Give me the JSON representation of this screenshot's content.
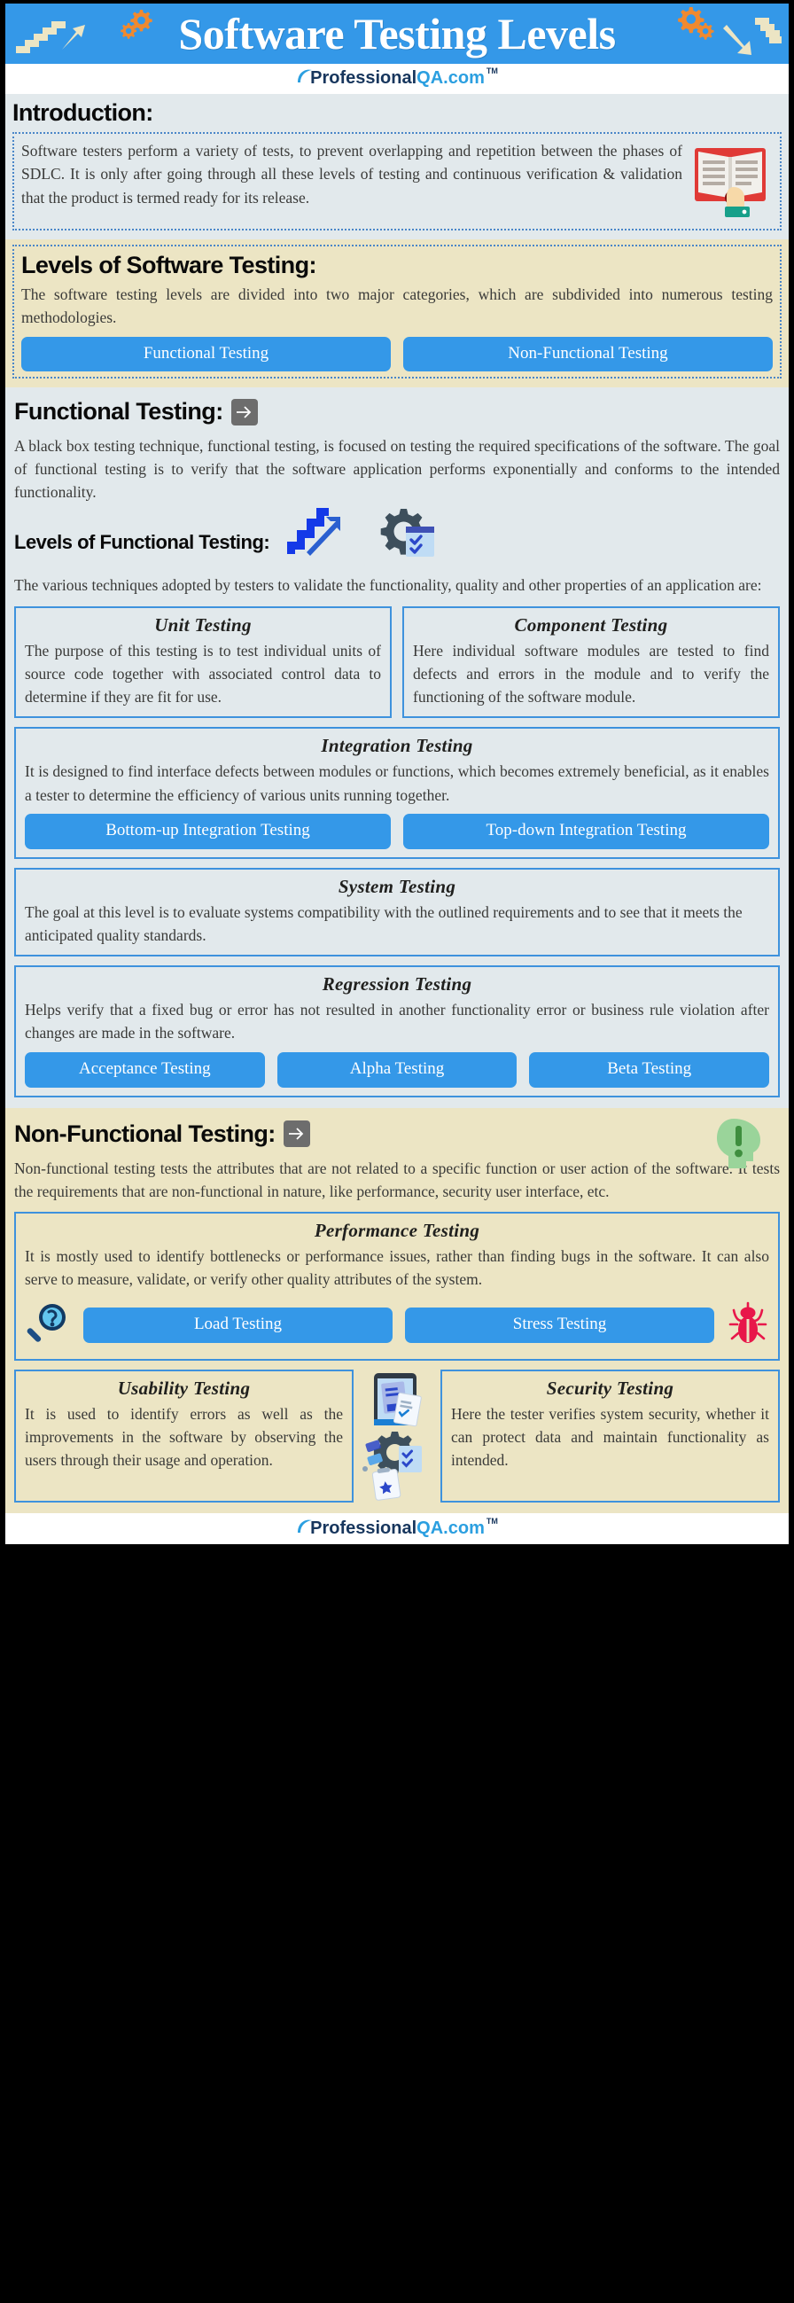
{
  "header": {
    "title": "Software Testing Levels",
    "banner_color": "#3498e8",
    "stairs_color": "#ece5c4",
    "gear_color": "#f0892f"
  },
  "logo": {
    "part1": "Professional",
    "part2": "QA",
    "part3": ".com",
    "tm": "TM",
    "color_dark": "#17365d",
    "color_blue": "#2b9fe0"
  },
  "introduction": {
    "heading": "Introduction:",
    "body": "Software testers perform a variety of tests, to prevent overlapping and repetition between the phases of SDLC. It is only after going through all these levels of testing and continuous verification & validation that the product is termed ready for its release.",
    "icon": "open-book-icon"
  },
  "levels": {
    "heading": "Levels of Software Testing:",
    "body": " The software testing levels are divided into two major categories, which are subdivided into numerous testing methodologies.",
    "buttons": [
      {
        "label": "Functional Testing"
      },
      {
        "label": "Non-Functional Testing"
      }
    ]
  },
  "functional": {
    "heading": "Functional Testing:",
    "arrow_icon": "arrow-right-icon",
    "body": "A black box testing technique, functional testing, is focused on testing the required specifications of the software. The goal of functional testing is to verify that the software application performs exponentially and conforms to the intended functionality.",
    "levels_heading": "Levels of Functional Testing:",
    "levels_body": "The various techniques adopted by testers to validate the functionality, quality and other properties of an application are:",
    "icons": [
      "stairs-up-arrow-icon",
      "gear-checklist-icon"
    ],
    "cards": [
      {
        "title": "Unit Testing",
        "body": "The purpose of this testing is to test individual units of source code together with associated control data to determine if they are fit for use."
      },
      {
        "title": "Component Testing",
        "body": "Here individual software modules are tested to find defects and errors in the module and to verify the functioning of the software module."
      }
    ],
    "integration": {
      "title": "Integration Testing",
      "body": "It is designed to find interface defects between modules or functions, which becomes extremely beneficial, as it enables a tester to determine the efficiency of various units running together.",
      "buttons": [
        {
          "label": "Bottom-up Integration Testing"
        },
        {
          "label": "Top-down Integration Testing"
        }
      ]
    },
    "system": {
      "title": "System Testing",
      "body": "The goal at this level is to evaluate systems compatibility with the outlined requirements and to see that it meets the anticipated quality standards."
    },
    "regression": {
      "title": "Regression Testing",
      "body": "Helps verify that a fixed bug or error has not resulted in another functionality error or business rule violation after changes are made in the software.",
      "buttons": [
        {
          "label": "Acceptance Testing"
        },
        {
          "label": "Alpha Testing"
        },
        {
          "label": "Beta Testing"
        }
      ]
    }
  },
  "nonfunctional": {
    "heading": "Non-Functional Testing:",
    "arrow_icon": "arrow-right-icon",
    "head_icon": "head-exclamation-icon",
    "body": "Non-functional testing tests the attributes that are not related to a specific function or user action of the software. It tests the requirements that are non-functional in nature, like performance, security user interface, etc.",
    "performance": {
      "title": "Performance Testing",
      "body": "It is mostly used to identify bottlenecks or performance issues, rather than finding bugs in the software. It can also serve to measure, validate, or verify other quality attributes of the system.",
      "left_icon": "magnifier-question-icon",
      "right_icon": "bug-icon",
      "buttons": [
        {
          "label": "Load Testing"
        },
        {
          "label": "Stress Testing"
        }
      ]
    },
    "cards": [
      {
        "title": "Usability Testing",
        "body": "It is used to identify errors as well as the improvements in the software by observing the users through their usage and operation."
      },
      {
        "title": "Security Testing",
        "body": "Here the tester verifies system security, whether it can protect data and maintain functionality as intended."
      }
    ],
    "middle_icon": "documents-gear-icon"
  },
  "colors": {
    "accent_blue": "#3498e8",
    "panel_blue": "#e2e9ec",
    "panel_beige": "#ece5c4",
    "border_blue": "#3e92dd",
    "page_border": "#000000"
  }
}
